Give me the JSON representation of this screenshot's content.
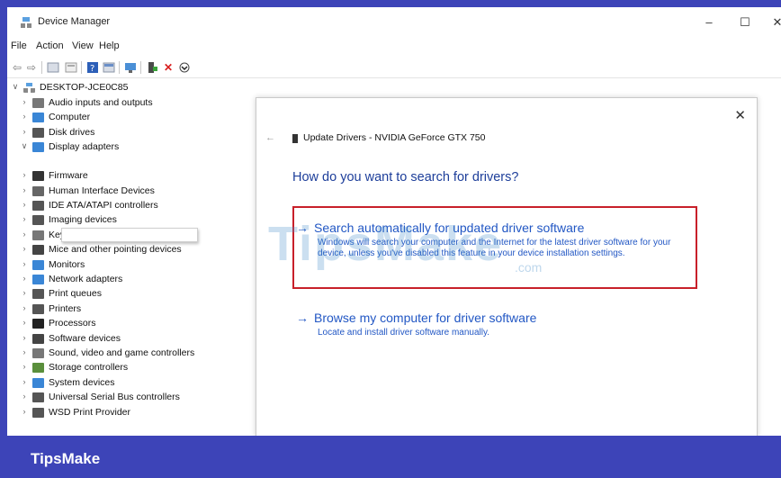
{
  "window": {
    "title": "Device Manager",
    "minimize": "–",
    "maximize": "☐",
    "close": "✕"
  },
  "menu": [
    "File",
    "Action",
    "View",
    "Help"
  ],
  "toolbar_icons": [
    "back-icon",
    "forward-icon",
    "properties-icon",
    "show-hidden-icon",
    "help-icon",
    "view-icon",
    "monitor-icon",
    "update-driver-icon",
    "uninstall-icon",
    "scan-icon"
  ],
  "tree": {
    "root": "DESKTOP-JCE0C85",
    "items": [
      {
        "label": "Audio inputs and outputs",
        "icon": "audio-icon",
        "expanded": false,
        "color": "#777777"
      },
      {
        "label": "Computer",
        "icon": "computer-icon",
        "expanded": false,
        "color": "#3a86d6"
      },
      {
        "label": "Disk drives",
        "icon": "disk-icon",
        "expanded": false,
        "color": "#555555"
      },
      {
        "label": "Display adapters",
        "icon": "display-icon",
        "expanded": true,
        "color": "#3a86d6"
      },
      {
        "label": "Firmware",
        "icon": "firmware-icon",
        "expanded": false,
        "color": "#333333"
      },
      {
        "label": "Human Interface Devices",
        "icon": "hid-icon",
        "expanded": false,
        "color": "#666666"
      },
      {
        "label": "IDE ATA/ATAPI controllers",
        "icon": "ide-icon",
        "expanded": false,
        "color": "#555555"
      },
      {
        "label": "Imaging devices",
        "icon": "camera-icon",
        "expanded": false,
        "color": "#555555"
      },
      {
        "label": "Keyboards",
        "icon": "keyboard-icon",
        "expanded": false,
        "color": "#777777"
      },
      {
        "label": "Mice and other pointing devices",
        "icon": "mouse-icon",
        "expanded": false,
        "color": "#444444"
      },
      {
        "label": "Monitors",
        "icon": "monitor-icon",
        "expanded": false,
        "color": "#3a86d6"
      },
      {
        "label": "Network adapters",
        "icon": "network-icon",
        "expanded": false,
        "color": "#3a86d6"
      },
      {
        "label": "Print queues",
        "icon": "print-queue-icon",
        "expanded": false,
        "color": "#555555"
      },
      {
        "label": "Printers",
        "icon": "printer-icon",
        "expanded": false,
        "color": "#555555"
      },
      {
        "label": "Processors",
        "icon": "processor-icon",
        "expanded": false,
        "color": "#222222"
      },
      {
        "label": "Software devices",
        "icon": "software-device-icon",
        "expanded": false,
        "color": "#444444"
      },
      {
        "label": "Sound, video and game controllers",
        "icon": "sound-icon",
        "expanded": false,
        "color": "#777777"
      },
      {
        "label": "Storage controllers",
        "icon": "storage-icon",
        "expanded": false,
        "color": "#5a8f3c"
      },
      {
        "label": "System devices",
        "icon": "system-icon",
        "expanded": false,
        "color": "#3a86d6"
      },
      {
        "label": "Universal Serial Bus controllers",
        "icon": "usb-icon",
        "expanded": false,
        "color": "#555555"
      },
      {
        "label": "WSD Print Provider",
        "icon": "wsd-printer-icon",
        "expanded": false,
        "color": "#555555"
      }
    ]
  },
  "dialog": {
    "close": "✕",
    "back": "←",
    "header": "Update Drivers - NVIDIA GeForce GTX 750",
    "question": "How do you want to search for drivers?",
    "option1": {
      "title": "Search automatically for updated driver software",
      "desc": "Windows will search your computer and the Internet for the latest driver software for your device, unless you've disabled this feature in your device installation settings."
    },
    "option2": {
      "title": "Browse my computer for driver software",
      "desc": "Locate and install driver software manually."
    },
    "arrow": "→"
  },
  "watermark": {
    "text": "TipsMake",
    "suffix": ".com"
  },
  "brand": "TipsMake",
  "colors": {
    "accent": "#3d44b8",
    "link": "#2257c4",
    "highlight": "#c8202a"
  }
}
